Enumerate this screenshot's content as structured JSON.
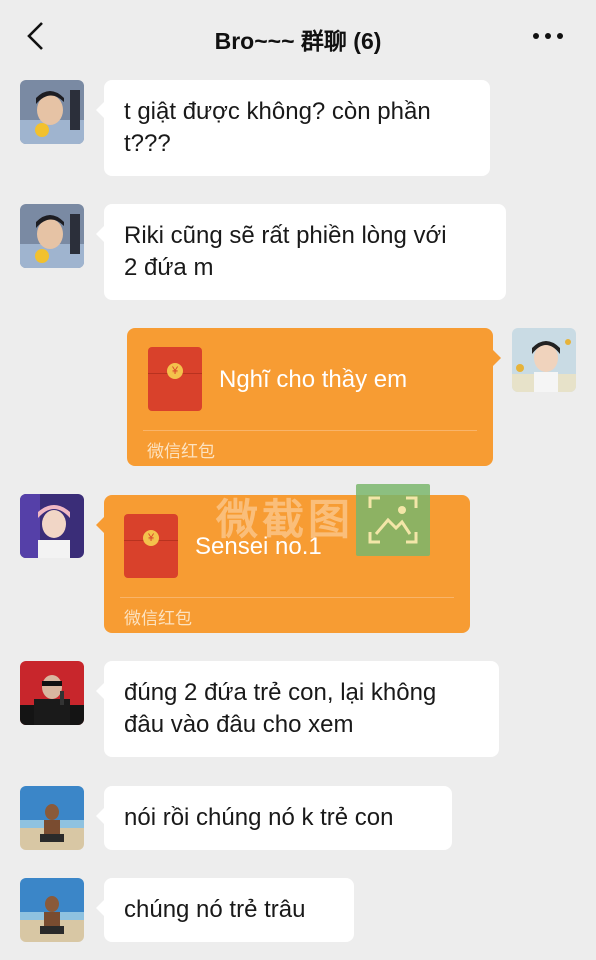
{
  "header": {
    "title": "Bro~~~ 群聊 (6)"
  },
  "messages": [
    {
      "type": "text",
      "side": "left",
      "text_line1": "t giật được không? còn phần",
      "text_line2": "t???",
      "avatar_icon": "man-avatar"
    },
    {
      "type": "text",
      "side": "left",
      "text_line1": "Riki cũng sẽ rất phiền lòng với",
      "text_line2": "2 đứa m",
      "avatar_icon": "man-avatar"
    },
    {
      "type": "red_packet",
      "side": "right",
      "title": "Nghĩ cho thầy em",
      "footer": "微信红包",
      "avatar_icon": "boy-avatar"
    },
    {
      "type": "red_packet",
      "side": "left",
      "title": "Sensei no.1",
      "footer": "微信红包",
      "avatar_icon": "singer-avatar"
    },
    {
      "type": "text",
      "side": "left",
      "text_line1": "đúng 2 đứa trẻ con, lại không",
      "text_line2": "đâu vào đâu cho xem",
      "avatar_icon": "rapper-avatar"
    },
    {
      "type": "text",
      "side": "left",
      "text_line1": "nói rồi chúng nó k trẻ con",
      "avatar_icon": "beach-avatar"
    },
    {
      "type": "text",
      "side": "left",
      "text_line1": "chúng nó trẻ trâu",
      "avatar_icon": "beach-avatar"
    }
  ],
  "red_packet_symbol": "¥",
  "watermark": "微截图",
  "colors": {
    "background": "#ededed",
    "bubble": "#ffffff",
    "red_packet": "#f79c33",
    "red_packet_icon": "#d9412b"
  }
}
